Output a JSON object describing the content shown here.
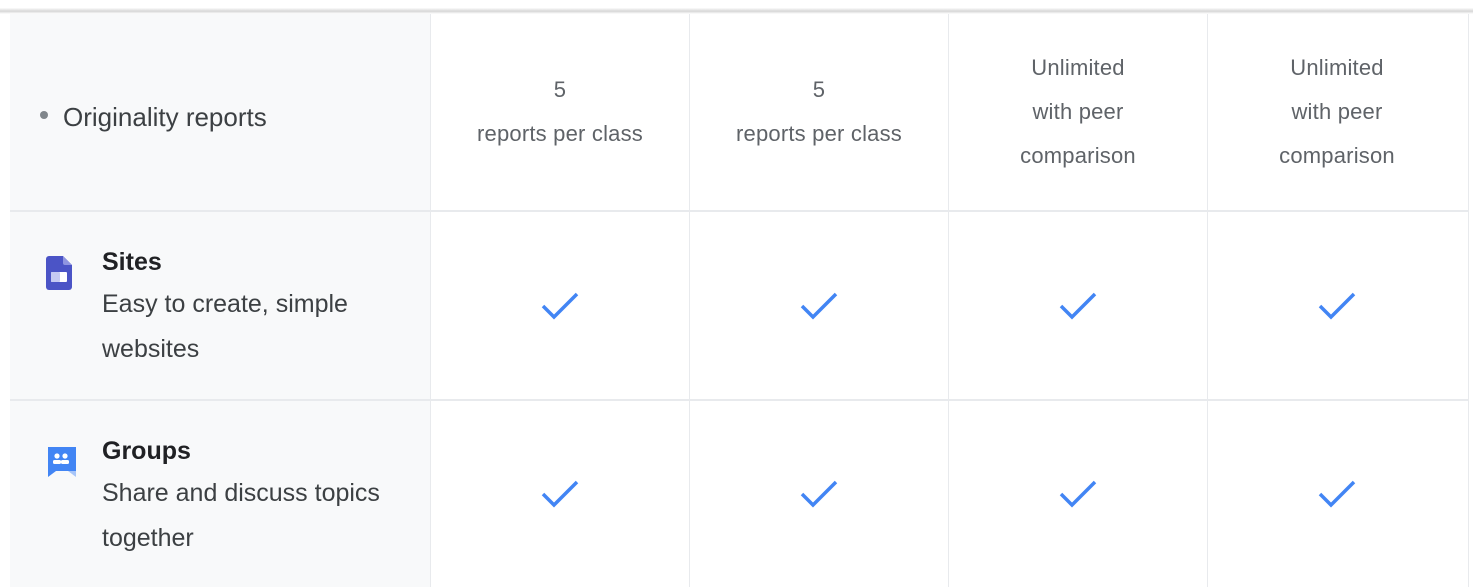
{
  "rows": [
    {
      "label": "Originality reports",
      "values": [
        {
          "line1": "5",
          "line2": "reports per class"
        },
        {
          "line1": "5",
          "line2": "reports per class"
        },
        {
          "line1": "Unlimited",
          "line2": "with peer",
          "line3": "comparison"
        },
        {
          "line1": "Unlimited",
          "line2": "with peer",
          "line3": "comparison"
        }
      ]
    },
    {
      "title": "Sites",
      "description": "Easy to create, simple websites",
      "icon": "google-sites-icon",
      "icon_color": "#4b54c6",
      "values": [
        "included",
        "included",
        "included",
        "included"
      ]
    },
    {
      "title": "Groups",
      "description": "Share and discuss topics together",
      "icon": "google-groups-icon",
      "icon_color": "#4285f4",
      "values": [
        "included",
        "included",
        "included",
        "included"
      ]
    }
  ],
  "colors": {
    "check": "#4285f4",
    "label_bg": "#f8f9fa",
    "grid_line": "#e8eaed"
  }
}
